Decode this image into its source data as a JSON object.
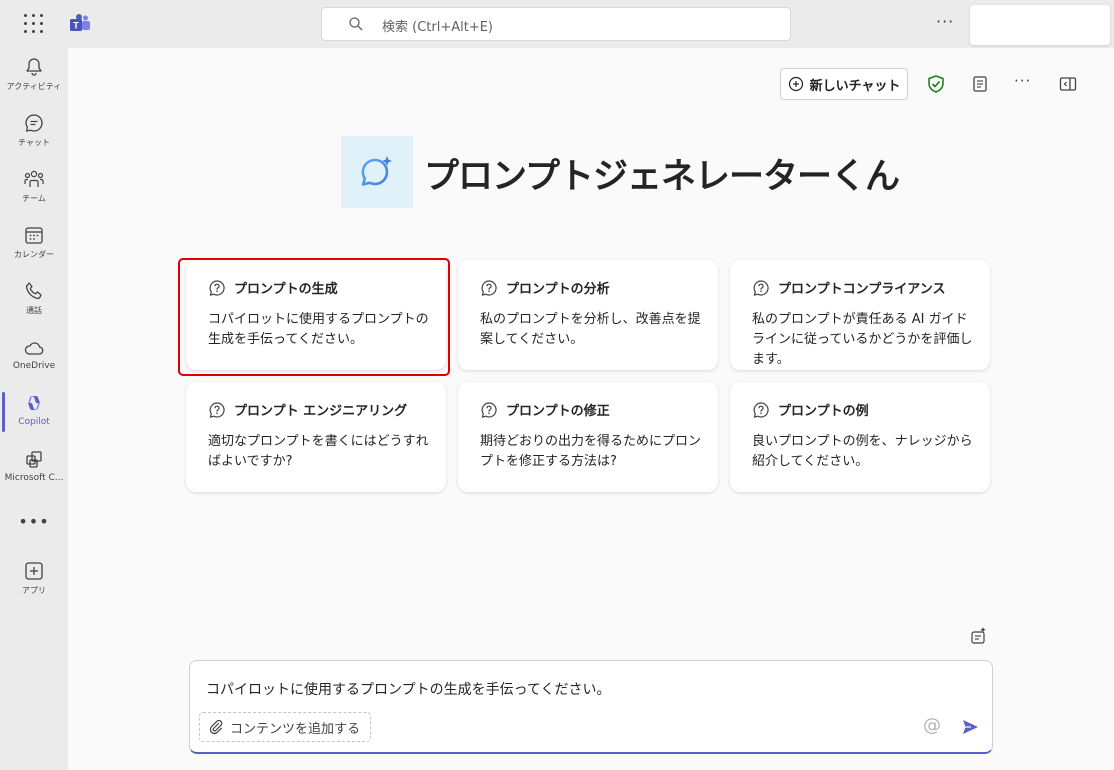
{
  "topbar": {
    "search_placeholder": "検索 (Ctrl+Alt+E)",
    "more": "···"
  },
  "rail": {
    "items": [
      {
        "label": "アクティビティ",
        "icon": "bell-icon"
      },
      {
        "label": "チャット",
        "icon": "chat-icon"
      },
      {
        "label": "チーム",
        "icon": "people-icon"
      },
      {
        "label": "カレンダー",
        "icon": "calendar-icon"
      },
      {
        "label": "通話",
        "icon": "phone-icon"
      },
      {
        "label": "OneDrive",
        "icon": "cloud-icon"
      },
      {
        "label": "Copilot",
        "icon": "copilot-icon",
        "active": true
      },
      {
        "label": "Microsoft C...",
        "icon": "apps-icon"
      }
    ],
    "more": "•••",
    "apps_label": "アプリ"
  },
  "header": {
    "new_chat_label": "新しいチャット",
    "more": "···"
  },
  "agent": {
    "title": "プロンプトジェネレーターくん"
  },
  "cards": [
    {
      "title": "プロンプトの生成",
      "desc": "コパイロットに使用するプロンプトの生成を手伝ってください。"
    },
    {
      "title": "プロンプトの分析",
      "desc": "私のプロンプトを分析し、改善点を提案してください。"
    },
    {
      "title": "プロンプトコンプライアンス",
      "desc": "私のプロンプトが責任ある AI ガイドラインに従っているかどうかを評価します。"
    },
    {
      "title": "プロンプト エンジニアリング",
      "desc": "適切なプロンプトを書くにはどうすればよいですか?"
    },
    {
      "title": "プロンプトの修正",
      "desc": "期待どおりの出力を得るためにプロンプトを修正する方法は?"
    },
    {
      "title": "プロンプトの例",
      "desc": "良いプロンプトの例を、ナレッジから紹介してください。"
    }
  ],
  "composer": {
    "text": "コパイロットに使用するプロンプトの生成を手伝ってください。",
    "add_content_label": "コンテンツを追加する",
    "at_symbol": "@"
  },
  "colors": {
    "accent": "#5b5fc7",
    "highlight": "#e00000",
    "shield": "#107c10"
  }
}
